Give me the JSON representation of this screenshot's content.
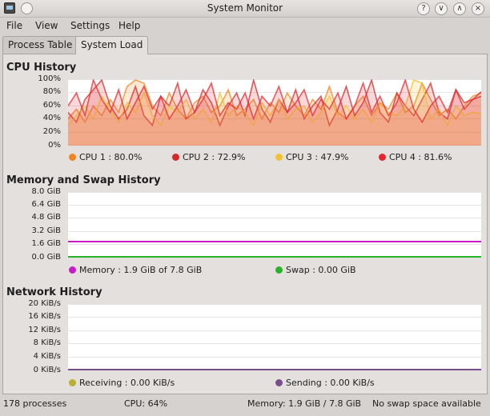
{
  "window": {
    "title": "System Monitor"
  },
  "menu": [
    "File",
    "View",
    "Settings",
    "Help"
  ],
  "tabs": [
    {
      "label": "Process Table",
      "active": false
    },
    {
      "label": "System Load",
      "active": true
    }
  ],
  "cpu": {
    "title": "CPU History",
    "yticks": [
      "100%",
      "80%",
      "60%",
      "40%",
      "20%",
      "0%"
    ],
    "legend": [
      {
        "label": "CPU 1 : 80.0%",
        "color": "#f0841e"
      },
      {
        "label": "CPU 2 : 72.9%",
        "color": "#d42a2a"
      },
      {
        "label": "CPU 3 : 47.9%",
        "color": "#f2c230"
      },
      {
        "label": "CPU 4 : 81.6%",
        "color": "#e8262e"
      }
    ]
  },
  "memory": {
    "title": "Memory and Swap History",
    "yticks": [
      "8.0 GiB",
      "6.4 GiB",
      "4.8 GiB",
      "3.2 GiB",
      "1.6 GiB",
      "0.0 GiB"
    ],
    "legend": [
      {
        "label": "Memory : 1.9 GiB of 7.8 GiB",
        "color": "#c61bc6"
      },
      {
        "label": "Swap : 0.00 GiB",
        "color": "#28b428"
      }
    ]
  },
  "network": {
    "title": "Network History",
    "yticks": [
      "20 KiB/s",
      "16 KiB/s",
      "12 KiB/s",
      "8 KiB/s",
      "4 KiB/s",
      "0 KiB/s"
    ],
    "legend": [
      {
        "label": "Receiving : 0.00 KiB/s",
        "color": "#b8b030"
      },
      {
        "label": "Sending : 0.00 KiB/s",
        "color": "#7a4e8c"
      }
    ]
  },
  "status": {
    "processes": "178 processes",
    "cpu": "CPU: 64%",
    "memory": "Memory: 1.9 GiB / 7.8 GiB",
    "swap": "No swap space available"
  },
  "chart_data": [
    {
      "type": "line",
      "ylim": [
        0,
        100
      ],
      "series": [
        {
          "name": "CPU 1",
          "color": "#f0841e",
          "values": [
            40,
            55,
            35,
            60,
            45,
            70,
            50,
            90,
            100,
            95,
            60,
            45,
            80,
            55,
            40,
            65,
            75,
            50,
            60,
            85,
            45,
            55,
            70,
            40,
            65,
            50,
            80,
            60,
            45,
            70,
            55,
            90,
            50,
            40,
            60,
            75,
            45,
            65,
            55,
            80,
            50,
            60,
            95,
            70,
            45,
            55,
            40,
            60,
            75,
            80
          ]
        },
        {
          "name": "CPU 2",
          "color": "#d42a2a",
          "values": [
            50,
            35,
            70,
            85,
            100,
            60,
            40,
            55,
            90,
            45,
            30,
            75,
            60,
            95,
            40,
            50,
            85,
            65,
            30,
            60,
            80,
            45,
            100,
            55,
            35,
            70,
            50,
            85,
            40,
            60,
            75,
            30,
            55,
            90,
            45,
            65,
            100,
            50,
            35,
            80,
            60,
            45,
            70,
            95,
            50,
            40,
            85,
            55,
            70,
            75
          ]
        },
        {
          "name": "CPU 3",
          "color": "#f2c230",
          "values": [
            30,
            45,
            60,
            40,
            75,
            55,
            35,
            65,
            50,
            80,
            45,
            30,
            60,
            50,
            70,
            40,
            55,
            35,
            80,
            45,
            60,
            50,
            30,
            65,
            45,
            70,
            40,
            55,
            60,
            35,
            50,
            75,
            45,
            60,
            40,
            55,
            35,
            65,
            50,
            45,
            60,
            100,
            95,
            40,
            55,
            30,
            60,
            45,
            50,
            48
          ]
        },
        {
          "name": "CPU 4",
          "color": "#e8262e",
          "values": [
            60,
            80,
            45,
            100,
            70,
            50,
            85,
            40,
            65,
            90,
            55,
            75,
            40,
            60,
            85,
            50,
            70,
            95,
            45,
            65,
            55,
            80,
            40,
            75,
            60,
            90,
            50,
            65,
            85,
            45,
            70,
            55,
            80,
            40,
            60,
            95,
            50,
            75,
            45,
            65,
            100,
            55,
            35,
            60,
            75,
            50,
            85,
            65,
            70,
            82
          ]
        }
      ]
    },
    {
      "type": "line",
      "ylim": [
        0,
        8.0
      ],
      "series": [
        {
          "name": "Memory",
          "color": "#c61bc6",
          "values": [
            1.9,
            1.9
          ]
        },
        {
          "name": "Swap",
          "color": "#28b428",
          "values": [
            0.0,
            0.0
          ]
        }
      ]
    },
    {
      "type": "line",
      "ylim": [
        0,
        20
      ],
      "series": [
        {
          "name": "Receiving",
          "color": "#b8b030",
          "values": [
            0,
            0
          ]
        },
        {
          "name": "Sending",
          "color": "#7a4e8c",
          "values": [
            0,
            0
          ]
        }
      ]
    }
  ]
}
